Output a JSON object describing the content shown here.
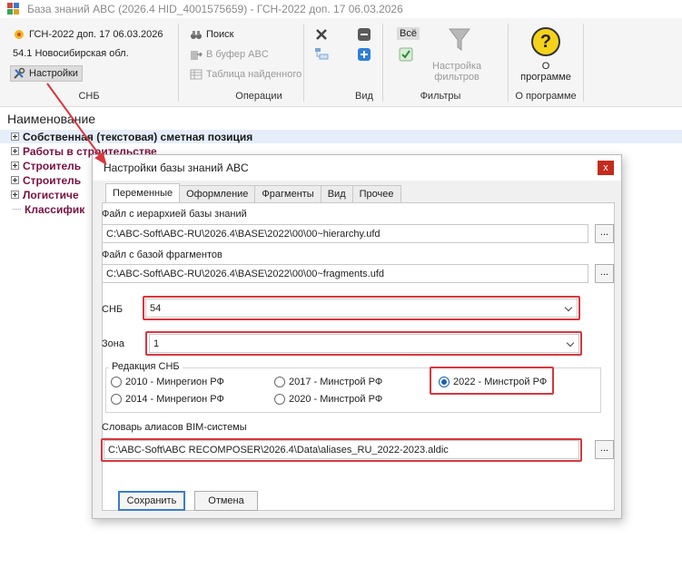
{
  "window": {
    "title": "База знаний ABC (2026.4 HID_4001575659) - ГСН-2022 доп. 17 06.03.2026"
  },
  "ribbon": {
    "snb": {
      "norm_base": "ГСН-2022 доп. 17 06.03.2026",
      "region": "54.1 Новосибирская обл.",
      "settings_label": "Настройки",
      "group_label": "СНБ"
    },
    "operations": {
      "search_label": "Поиск",
      "to_buffer_label": "В буфер ABC",
      "found_table_label": "Таблица найденного",
      "group_label": "Операции"
    },
    "view": {
      "group_label": "Вид"
    },
    "filters": {
      "all_label": "Всё",
      "filter_settings_line1": "Настройка",
      "filter_settings_line2": "фильтров",
      "group_label": "Фильтры"
    },
    "about": {
      "button_line1": "О",
      "button_line2": "программе",
      "group_label": "О программе",
      "icon_glyph": "?"
    }
  },
  "tree": {
    "header": "Наименование",
    "rows": [
      {
        "label": "Собственная (текстовая) сметная позиция",
        "color": "#1a1a1a"
      },
      {
        "label": "Работы в строительстве",
        "color": "#7a1040"
      },
      {
        "label": "Строитель",
        "color": "#7a1040"
      },
      {
        "label": "Строитель",
        "color": "#7a1040"
      },
      {
        "label": "Логистиче",
        "color": "#7a1040"
      },
      {
        "label": "Классифик",
        "color": "#7a1040"
      }
    ]
  },
  "dialog": {
    "title": "Настройки базы знаний ABC",
    "close_glyph": "x",
    "tabs": [
      "Переменные",
      "Оформление",
      "Фрагменты",
      "Вид",
      "Прочее"
    ],
    "hierarchy_file": {
      "label": "Файл с иерархией базы знаний",
      "value": "C:\\ABC-Soft\\ABC-RU\\2026.4\\BASE\\2022\\00\\00~hierarchy.ufd"
    },
    "fragments_file": {
      "label": "Файл с базой фрагментов",
      "value": "C:\\ABC-Soft\\ABC-RU\\2026.4\\BASE\\2022\\00\\00~fragments.ufd"
    },
    "browse_label": "...",
    "snb": {
      "label": "СНБ",
      "value": "54"
    },
    "zone": {
      "label": "Зона",
      "value": "1"
    },
    "edition": {
      "title": "Редакция СНБ",
      "options": [
        "2010 - Минрегион РФ",
        "2014 - Минрегион РФ",
        "2017 - Минстрой РФ",
        "2020 - Минстрой РФ",
        "2022 - Минстрой РФ"
      ],
      "selected": "2022 - Минстрой РФ"
    },
    "bim_aliases": {
      "label": "Словарь алиасов BIM-системы",
      "value": "C:\\ABC-Soft\\ABC RECOMPOSER\\2026.4\\Data\\aliases_RU_2022-2023.aldic"
    },
    "save_label": "Сохранить",
    "cancel_label": "Отмена"
  },
  "colors": {
    "highlight": "#d9363e",
    "accent": "#1a5fb4",
    "tree_item": "#7a1040"
  }
}
